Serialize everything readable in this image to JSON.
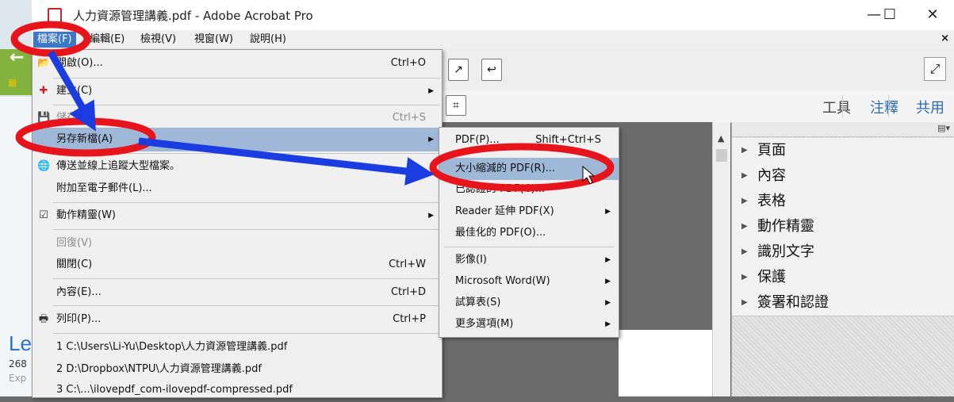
{
  "window": {
    "title": "人力資源管理講義.pdf - Adobe Acrobat Pro",
    "minimize": "—",
    "maximize": "☐",
    "close": "✕"
  },
  "menubar": {
    "items": [
      "檔案(F)",
      "編輯(E)",
      "檢視(V)",
      "視窗(W)",
      "說明(H)"
    ],
    "close_x": "×"
  },
  "toolbar": {
    "tabs": [
      "工具",
      "注釋",
      "共用"
    ]
  },
  "file_menu": {
    "open": {
      "label": "開啟(O)...",
      "shortcut": "Ctrl+O"
    },
    "create": {
      "label": "建立(C)"
    },
    "save": {
      "label": "儲存(S)",
      "shortcut": "Ctrl+S"
    },
    "save_as": {
      "label": "另存新檔(A)"
    },
    "send_track": {
      "label": "傳送並線上追蹤大型檔案。"
    },
    "attach_email": {
      "label": "附加至電子郵件(L)..."
    },
    "action_wizard": {
      "label": "動作精靈(W)"
    },
    "revert": {
      "label": "回復(V)"
    },
    "close": {
      "label": "關閉(C)",
      "shortcut": "Ctrl+W"
    },
    "properties": {
      "label": "內容(E)...",
      "shortcut": "Ctrl+D"
    },
    "print": {
      "label": "列印(P)...",
      "shortcut": "Ctrl+P"
    },
    "recent": [
      "1 C:\\Users\\Li-Yu\\Desktop\\人力資源管理講義.pdf",
      "2 D:\\Dropbox\\NTPU\\人力資源管理講義.pdf",
      "3 C:\\...\\ilovepdf_com-ilovepdf-compressed.pdf"
    ]
  },
  "save_as_submenu": {
    "pdf": {
      "label": "PDF(P)...",
      "shortcut": "Shift+Ctrl+S"
    },
    "reduced": {
      "label": "大小縮減的 PDF(R)..."
    },
    "certified": {
      "label": "已認證的 PDF(C)..."
    },
    "reader_ext": {
      "label": "Reader 延伸 PDF(X)"
    },
    "optimized": {
      "label": "最佳化的 PDF(O)..."
    },
    "image": {
      "label": "影像(I)"
    },
    "word": {
      "label": "Microsoft Word(W)"
    },
    "spreadsheet": {
      "label": "試算表(S)"
    },
    "more": {
      "label": "更多選項(M)"
    }
  },
  "right_panel": {
    "sections": [
      "頁面",
      "內容",
      "表格",
      "動作精靈",
      "識別文字",
      "保護",
      "簽署和認證"
    ]
  },
  "background": {
    "partial_title": "Le",
    "partial_count": "268",
    "partial_label": "Exp"
  },
  "colors": {
    "menu_highlight": "#9fb8d8",
    "menubar_selected": "#3d78c8",
    "annotation_red": "#e8141b",
    "annotation_blue": "#1a3ce0"
  }
}
